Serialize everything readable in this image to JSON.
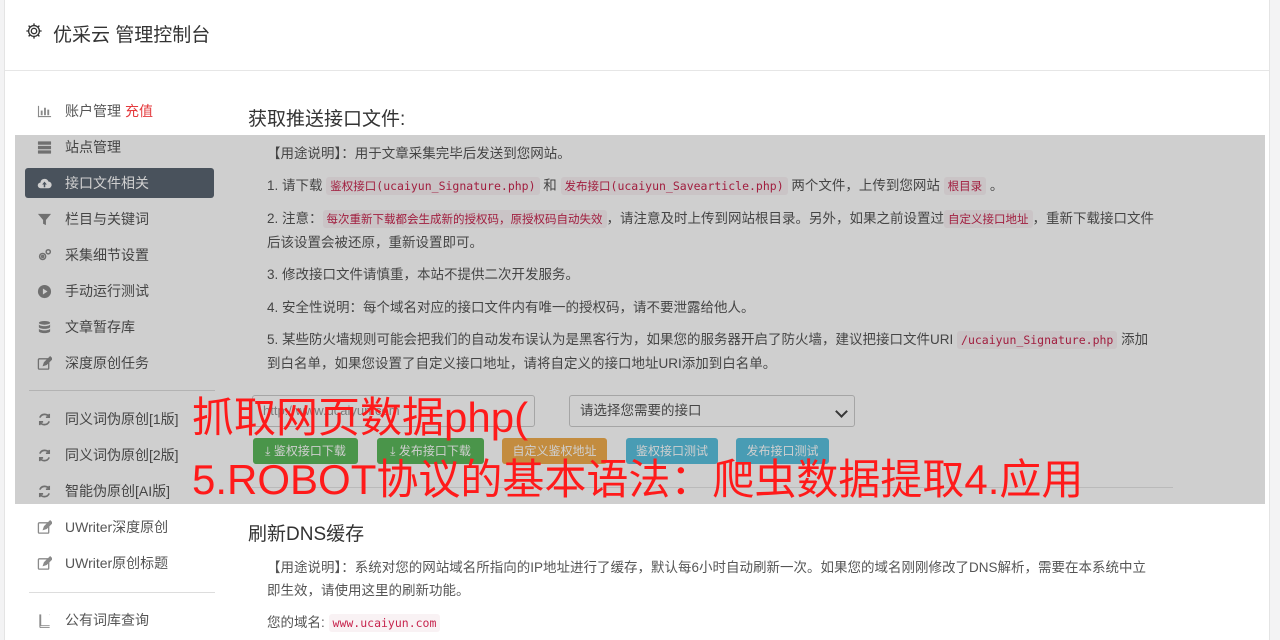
{
  "header": {
    "title": "优采云 管理控制台",
    "icon": "gear-icon"
  },
  "sidebar": {
    "items": [
      {
        "label": "账户管理",
        "badge": "充值",
        "icon": "bar-chart-icon"
      },
      {
        "label": "站点管理",
        "icon": "server-icon"
      },
      {
        "label": "接口文件相关",
        "icon": "cloud-upload-icon",
        "active": true
      },
      {
        "label": "栏目与关键词",
        "icon": "filter-icon"
      },
      {
        "label": "采集细节设置",
        "icon": "cogs-icon"
      },
      {
        "label": "手动运行测试",
        "icon": "play-circle-icon"
      },
      {
        "label": "文章暂存库",
        "icon": "database-icon"
      },
      {
        "label": "深度原创任务",
        "icon": "edit-icon"
      },
      {
        "label": "同义词伪原创[1版]",
        "icon": "refresh-icon"
      },
      {
        "label": "同义词伪原创[2版]",
        "icon": "refresh-icon"
      },
      {
        "label": "智能伪原创[AI版]",
        "icon": "refresh-icon"
      },
      {
        "label": "UWriter深度原创",
        "icon": "edit-icon"
      },
      {
        "label": "UWriter原创标题",
        "icon": "edit-icon"
      },
      {
        "label": "公有词库查询",
        "icon": "book-icon"
      }
    ]
  },
  "section1": {
    "title": "获取推送接口文件:",
    "usage_label": "【用途说明】",
    "usage_text": "：用于文章采集完毕后发送到您网站。",
    "p1_a": "1. 请下载 ",
    "p1_code1": "鉴权接口(ucaiyun_Signature.php)",
    "p1_b": " 和 ",
    "p1_code2": "发布接口(ucaiyun_Savearticle.php)",
    "p1_c": " 两个文件，上传到您网站 ",
    "p1_code3": "根目录",
    "p1_d": " 。",
    "p2_a": "2. 注意：",
    "p2_code1": "每次重新下载都会生成新的授权码，原授权码自动失效",
    "p2_b": "，请注意及时上传到网站根目录。另外，如果之前设置过",
    "p2_code2": "自定义接口地址",
    "p2_c": "，重新下载接口文件后该设置会被还原，重新设置即可。",
    "p3": "3. 修改接口文件请慎重，本站不提供二次开发服务。",
    "p4": "4. 安全性说明：每个域名对应的接口文件内有唯一的授权码，请不要泄露给他人。",
    "p5_a": "5. 某些防火墙规则可能会把我们的自动发布误认为是黑客行为，如果您的服务器开启了防火墙，建议把接口文件URI ",
    "p5_code": "/ucaiyun_Signature.php",
    "p5_b": " 添加到白名单，如果您设置了自定义接口地址，请将自定义的接口地址URI添加到白名单。",
    "url_placeholder": "http://www.ucaiyun.com",
    "select_value": "请选择您需要的接口",
    "btn_download_sign": "鉴权接口下载",
    "btn_download_publish": "发布接口下载",
    "btn_custom": "自定义鉴权地址",
    "btn_test_sign": "鉴权接口测试",
    "btn_test_publish": "发布接口测试"
  },
  "section2": {
    "title": "刷新DNS缓存",
    "usage_label": "【用途说明】",
    "usage_text": "：系统对您的网站域名所指向的IP地址进行了缓存，默认每6小时自动刷新一次。如果您的域名刚刚修改了DNS解析，需要在本系统中立即生效，请使用这里的刷新功能。",
    "domain_label": "您的域名:",
    "domain_value": "www.ucaiyun.com"
  },
  "overlay": {
    "line1": "抓取网页数据php(",
    "line2": "5.ROBOT协议的基本语法：爬虫数据提取4.应用"
  },
  "colors": {
    "active_nav": "#5b6572",
    "recharge": "#e4393c",
    "code": "#c7254e",
    "overlay_text": "#ff1a1a"
  }
}
